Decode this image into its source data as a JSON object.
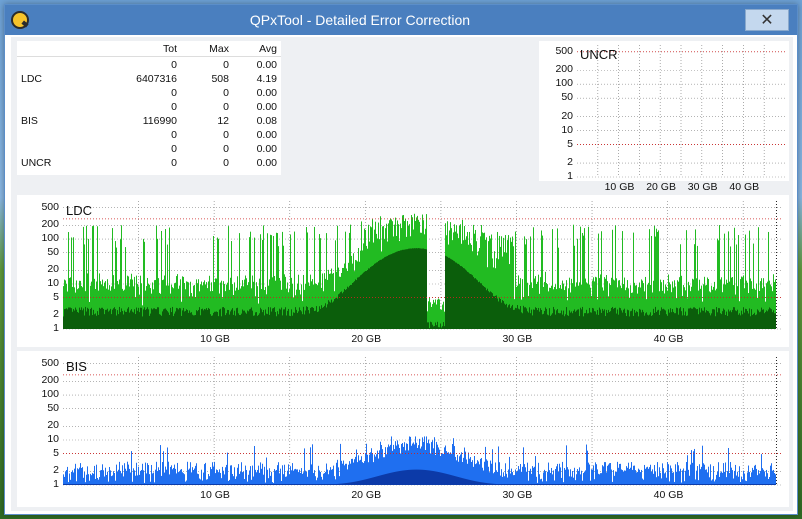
{
  "window": {
    "title": "QPxTool - Detailed Error Correction",
    "close_label": "✕",
    "icon": "qpxtool-logo-icon"
  },
  "stats": {
    "headers": [
      "",
      "Tot",
      "Max",
      "Avg"
    ],
    "rows": [
      [
        "",
        "0",
        "0",
        "0.00"
      ],
      [
        "LDC",
        "6407316",
        "508",
        "4.19"
      ],
      [
        "",
        "0",
        "0",
        "0.00"
      ],
      [
        "",
        "0",
        "0",
        "0.00"
      ],
      [
        "BIS",
        "116990",
        "12",
        "0.08"
      ],
      [
        "",
        "0",
        "0",
        "0.00"
      ],
      [
        "",
        "0",
        "0",
        "0.00"
      ],
      [
        "UNCR",
        "0",
        "0",
        "0.00"
      ]
    ]
  },
  "chart_data": [
    {
      "type": "bar",
      "title": "UNCR",
      "y_scale": "log",
      "y_ticks": [
        "500",
        "200",
        "100",
        "50",
        "20",
        "10",
        "5",
        "2",
        "1"
      ],
      "x_ticks": [
        "10 GB",
        "20 GB",
        "30 GB",
        "40 GB"
      ],
      "xlim": [
        0,
        50
      ],
      "red_lines": [
        500,
        5
      ],
      "series": [],
      "colors": {
        "red_line": "#cc2222",
        "grid": "#888888"
      }
    },
    {
      "type": "bar",
      "title": "LDC",
      "y_scale": "log",
      "y_ticks": [
        "500",
        "200",
        "100",
        "50",
        "20",
        "10",
        "5",
        "2",
        "1"
      ],
      "x_ticks": [
        "10 GB",
        "20 GB",
        "30 GB",
        "40 GB"
      ],
      "xlim": [
        0,
        47.5
      ],
      "data_end_gb": 47.2,
      "red_lines": [
        280,
        5
      ],
      "colors": {
        "peak": "#22bb22",
        "base": "#0b5e0b",
        "red_line": "#cc2222",
        "grid": "#888888"
      }
    },
    {
      "type": "bar",
      "title": "BIS",
      "y_scale": "log",
      "y_ticks": [
        "500",
        "200",
        "100",
        "50",
        "20",
        "10",
        "5",
        "2",
        "1"
      ],
      "x_ticks": [
        "10 GB",
        "20 GB",
        "30 GB",
        "40 GB"
      ],
      "xlim": [
        0,
        47.5
      ],
      "data_end_gb": 47.2,
      "red_lines": [
        280,
        5
      ],
      "colors": {
        "peak": "#1f6ff0",
        "base": "#0c3aa8",
        "red_line": "#cc2222",
        "grid": "#888888"
      }
    }
  ]
}
